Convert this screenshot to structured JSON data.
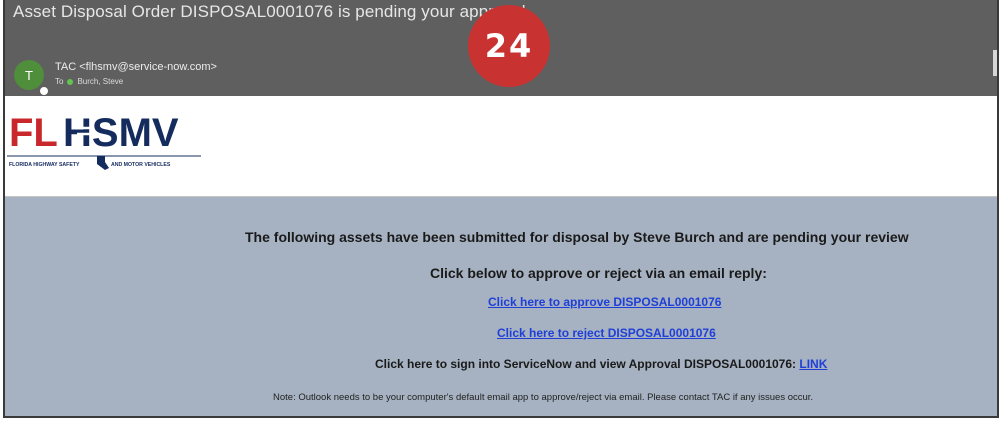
{
  "email": {
    "subject": "Asset Disposal Order DISPOSAL0001076 is pending your approval",
    "avatar_initial": "T",
    "sender": "TAC <flhsmv@service-now.com>",
    "to_label": "To",
    "recipient": "Burch, Steve"
  },
  "logo": {
    "text": "FLHSMV",
    "tagline_left": "FLORIDA HIGHWAY SAFETY",
    "tagline_right": "AND MOTOR VEHICLES",
    "colors": {
      "fl": "#c8282b",
      "hsmv": "#142b5e"
    }
  },
  "message": {
    "intro": "The following assets have been submitted for disposal by Steve Burch and are pending your review",
    "instruction": "Click below to approve or reject via an email reply:",
    "approve_link": "Click here to approve DISPOSAL0001076",
    "reject_link": "Click here to reject DISPOSAL0001076",
    "signin_text": "Click here to sign into ServiceNow and view Approval DISPOSAL0001076:",
    "signin_link": "LINK",
    "note": "Note: Outlook needs to be your computer's default email app to approve/reject via email. Please contact TAC if any issues occur."
  },
  "badge": {
    "number": "24",
    "color": "#c83331"
  }
}
